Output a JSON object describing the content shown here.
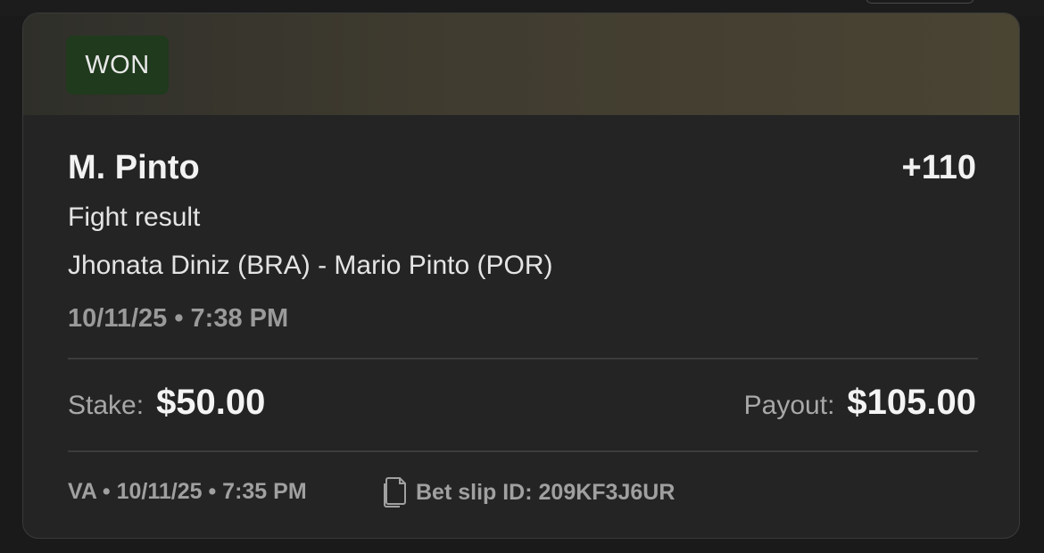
{
  "bet": {
    "status": "WON",
    "selection": "M. Pinto",
    "odds": "+110",
    "market": "Fight result",
    "event": "Jhonata Diniz (BRA) - Mario Pinto (POR)",
    "event_datetime": "10/11/25 • 7:38 PM",
    "stake_label": "Stake:",
    "stake_value": "$50.00",
    "payout_label": "Payout:",
    "payout_value": "$105.00",
    "placed_meta": "VA • 10/11/25 • 7:35 PM",
    "slip_id_text": "Bet slip ID: 209KF3J6UR"
  },
  "icons": {
    "slip": "copy-icon"
  },
  "colors": {
    "status_badge_bg": "#1f3a1c",
    "card_bg": "#242424"
  }
}
